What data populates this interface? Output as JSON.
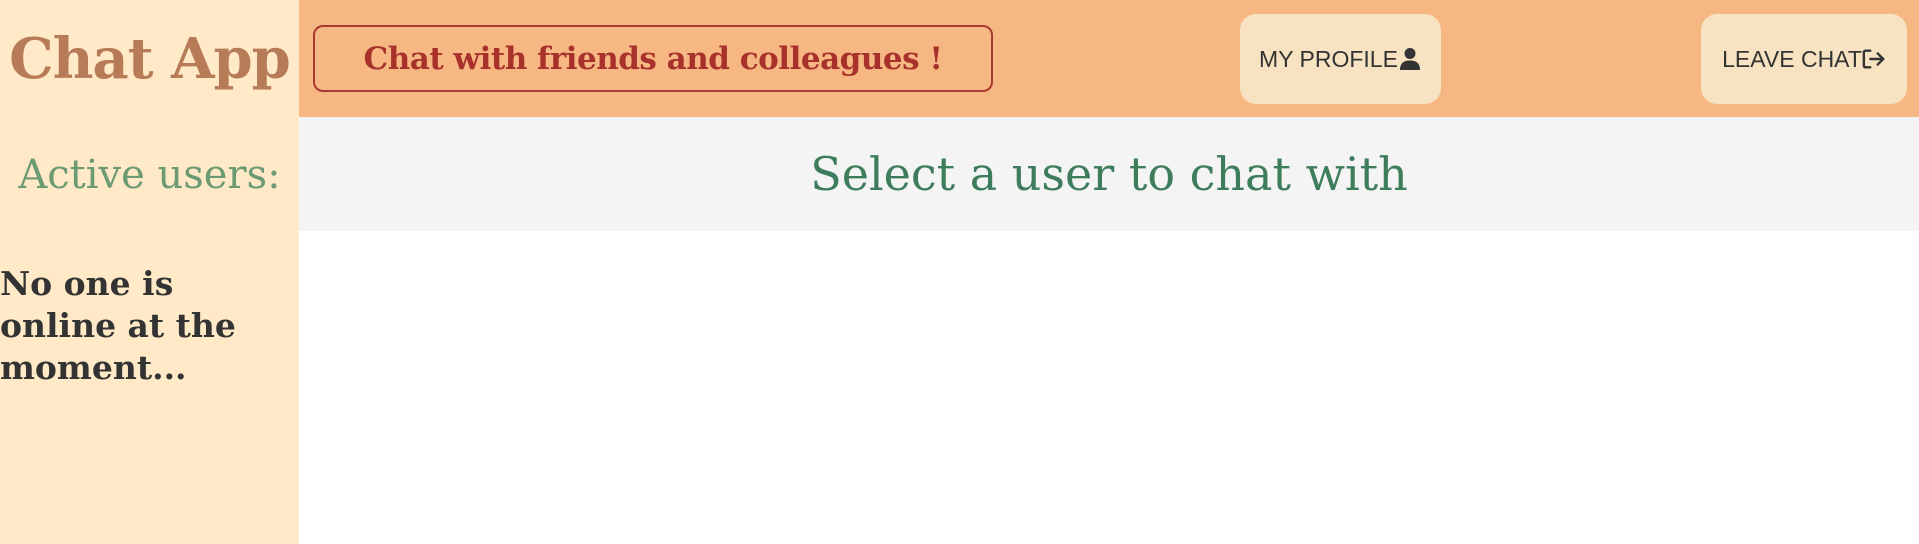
{
  "sidebar": {
    "brand": "Chat App",
    "active_users_label": "Active users:",
    "empty_message": "No one is online at the moment..."
  },
  "header": {
    "tagline": "Chat with friends and colleagues !",
    "profile_button": {
      "label": "MY PROFILE",
      "icon": "user-icon"
    },
    "leave_button": {
      "label": "LEAVE CHAT",
      "icon": "logout-icon"
    }
  },
  "main": {
    "prompt": "Select a user to chat with"
  },
  "colors": {
    "sidebar_bg": "#ffe9c6",
    "header_bg": "#f6b783",
    "button_bg": "#f7e3c1",
    "brand": "#b77b58",
    "tagline": "#a8322b",
    "active_users": "#6b9a73",
    "prompt": "#3e7d5b",
    "text": "#333333"
  }
}
